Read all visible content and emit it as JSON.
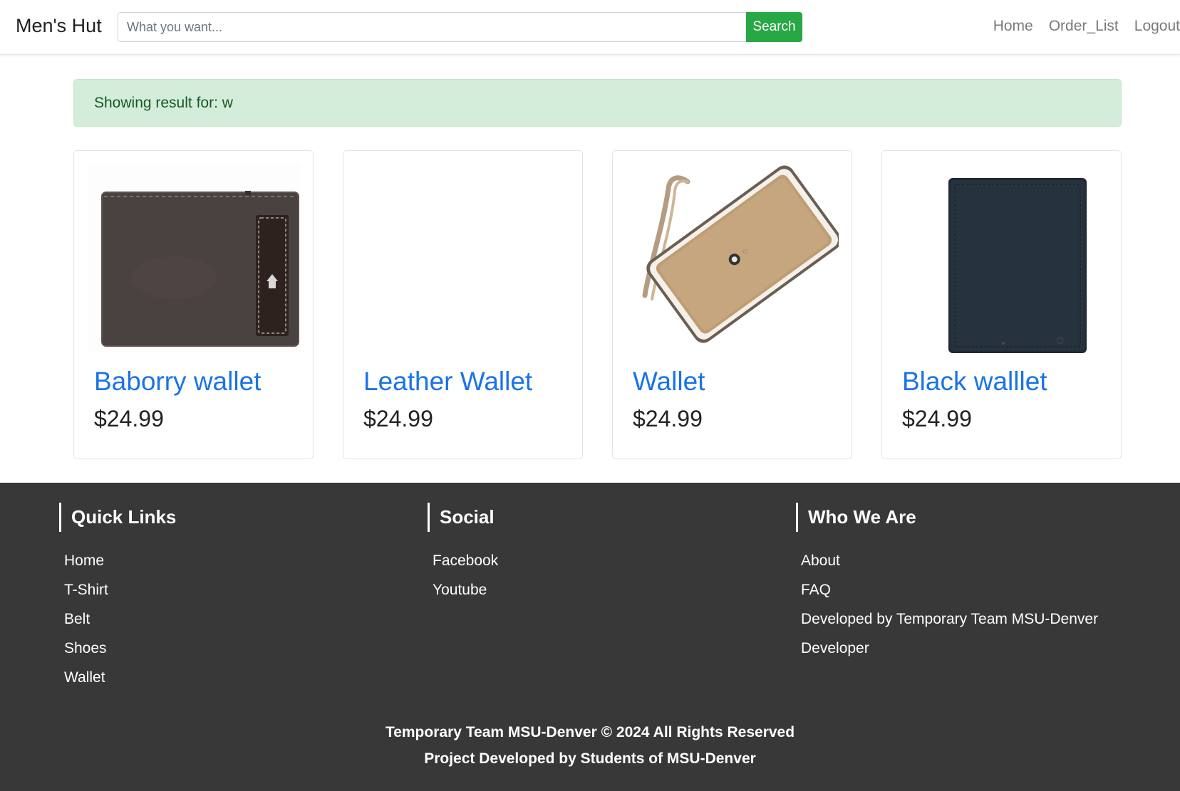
{
  "navbar": {
    "brand": "Men's Hut",
    "search_placeholder": "What you want...",
    "search_value": "",
    "search_button": "Search",
    "links": [
      "Home",
      "Order_List",
      "Logout"
    ]
  },
  "alert": {
    "text": "Showing result for: w"
  },
  "products": [
    {
      "title": "Baborry wallet",
      "price": "$24.99",
      "image": "brown-wallet-image"
    },
    {
      "title": "Leather Wallet",
      "price": "$24.99",
      "image": "blank-image"
    },
    {
      "title": "Wallet",
      "price": "$24.99",
      "image": "tan-clutch-wallet-image"
    },
    {
      "title": "Black walllet",
      "price": "$24.99",
      "image": "black-wallet-image"
    }
  ],
  "footer": {
    "quick_links": {
      "heading": "Quick Links",
      "items": [
        "Home",
        "T-Shirt",
        "Belt",
        "Shoes",
        "Wallet"
      ]
    },
    "social": {
      "heading": "Social",
      "items": [
        "Facebook",
        "Youtube"
      ]
    },
    "who_we_are": {
      "heading": "Who We Are",
      "items": [
        "About",
        "FAQ",
        "Developed by Temporary Team MSU-Denver",
        "Developer"
      ]
    },
    "copyright": "Temporary Team MSU-Denver © 2024 All Rights Reserved",
    "credit": "Project Developed by Students of MSU-Denver"
  },
  "colors": {
    "accent_green": "#28a745",
    "link_blue": "#1a73e8",
    "alert_bg": "#d4edda",
    "footer_bg": "#383838"
  }
}
